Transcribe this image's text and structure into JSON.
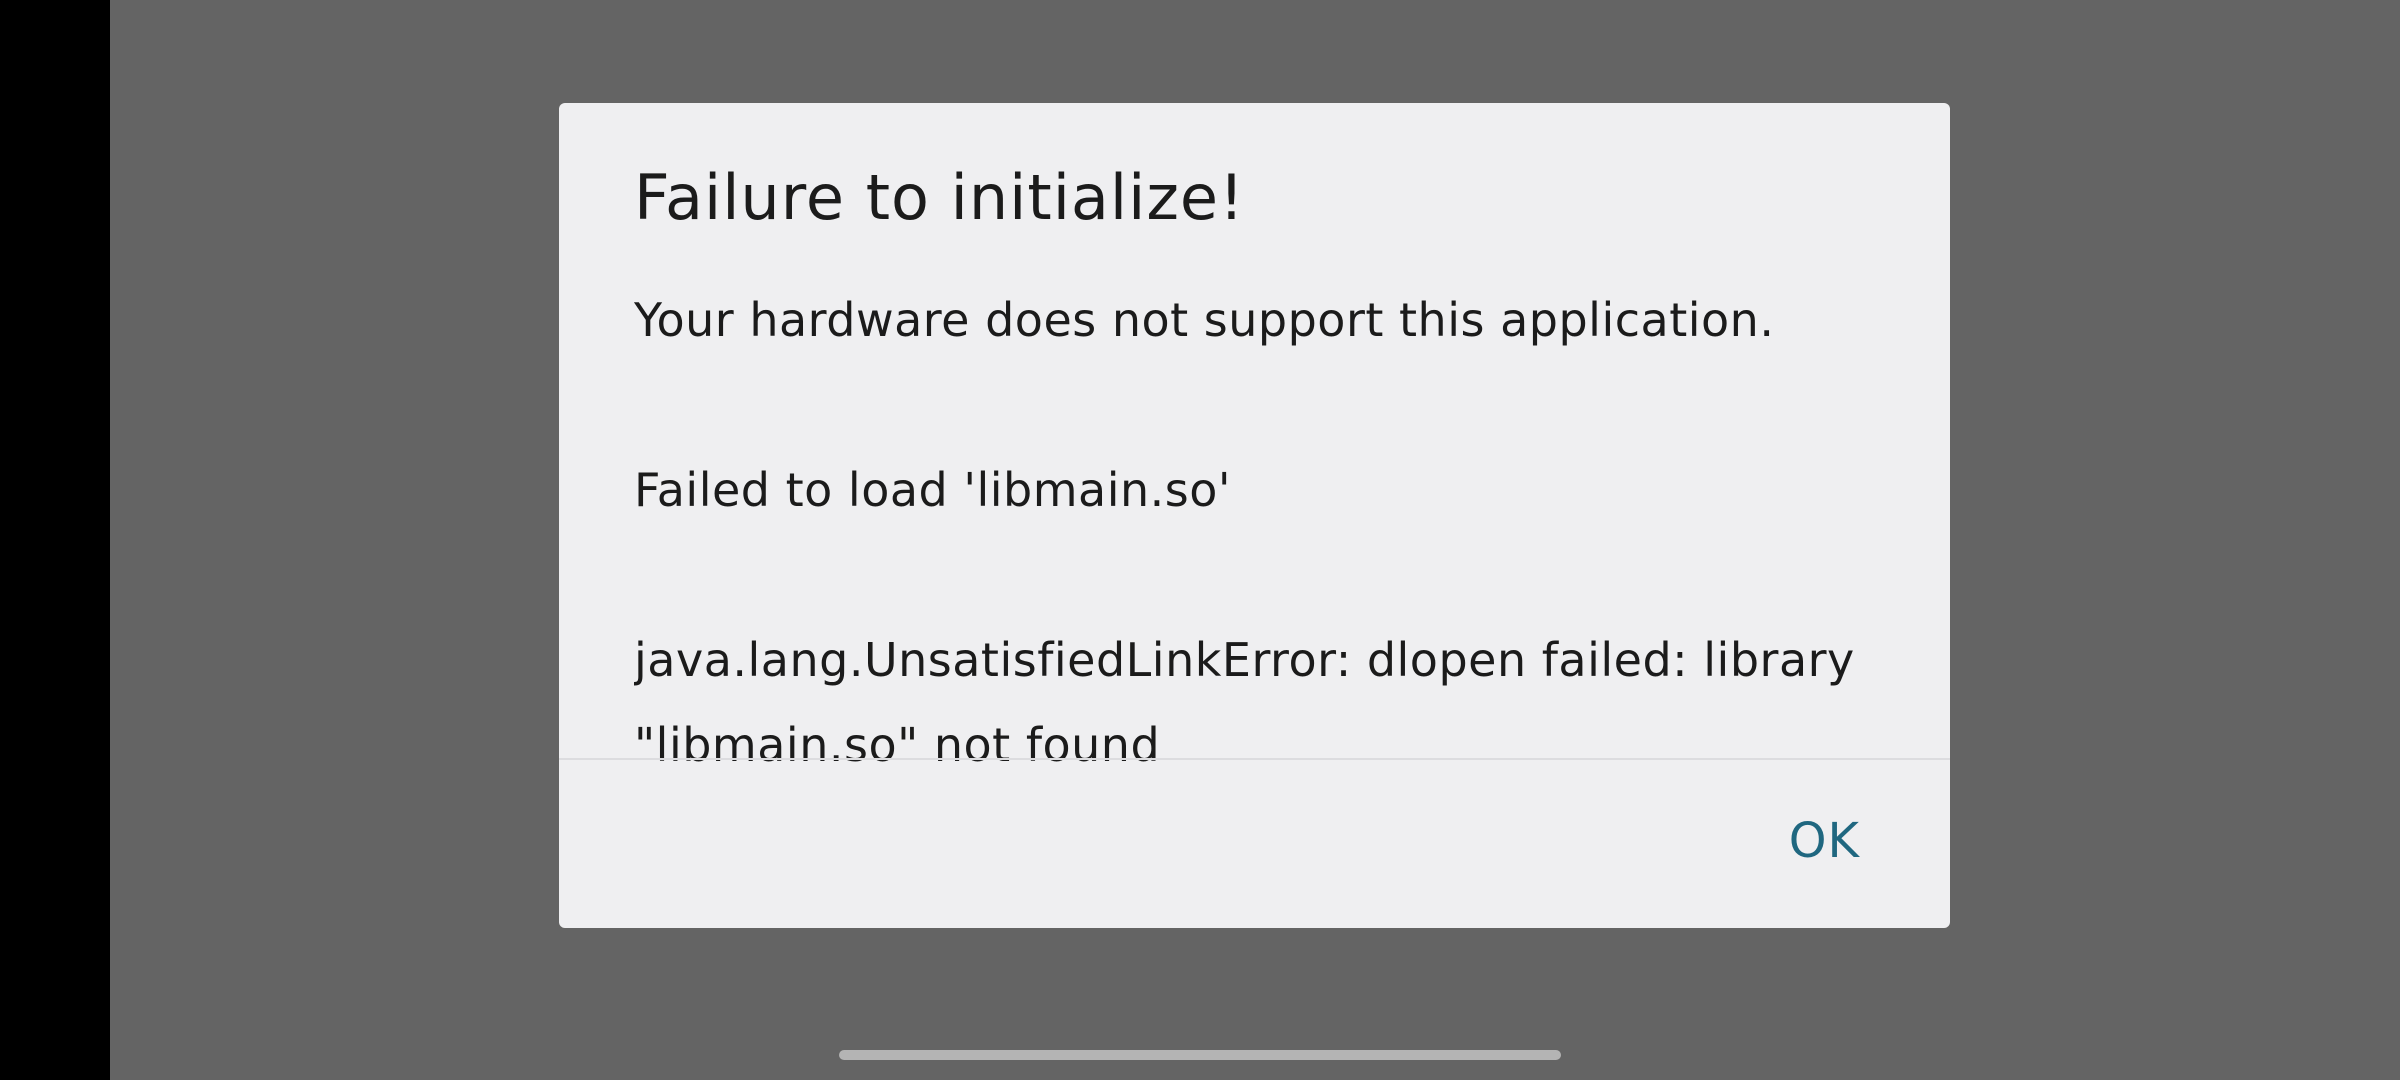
{
  "dialog": {
    "title": "Failure to initialize!",
    "message_line_1": "Your hardware does not support this application.",
    "message_line_2": "Failed to load 'libmain.so'",
    "message_line_3": "java.lang.UnsatisfiedLinkError: dlopen failed: library \"libmain.so\" not found",
    "ok_label": "OK"
  },
  "colors": {
    "scrim": "#646464",
    "dialog_background": "#efeff1",
    "text": "#1b1b1b",
    "accent": "#1f6780"
  }
}
